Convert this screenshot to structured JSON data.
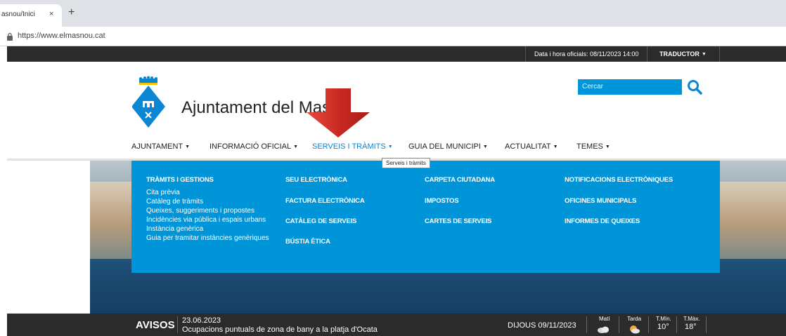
{
  "browser": {
    "tab_title": "asnou/Inici",
    "tab_close": "×",
    "new_tab": "+",
    "url": "https://www.elmasnou.cat"
  },
  "topbar": {
    "datetime": "Data i hora oficials: 08/11/2023 14:00",
    "translator": "TRADUCTOR"
  },
  "header": {
    "title": "Ajuntament del Mas",
    "search_placeholder": "Cercar"
  },
  "nav": {
    "items": [
      {
        "label": "AJUNTAMENT",
        "active": false
      },
      {
        "label": "INFORMACIÓ OFICIAL",
        "active": false
      },
      {
        "label": "SERVEIS I TRÀMITS",
        "active": true
      },
      {
        "label": "GUIA DEL MUNICIPI",
        "active": false
      },
      {
        "label": "ACTUALITAT",
        "active": false
      },
      {
        "label": "TEMES",
        "active": false
      }
    ],
    "tooltip": "Serveis i tràmits"
  },
  "mega_menu": {
    "col1": {
      "heading": "TRÀMITS I GESTIONS",
      "links": [
        "Cita prèvia",
        "Catàleg de tràmits",
        "Queixes, suggeriments i propostes",
        "Incidències via pública i espais urbans",
        "Instància genèrica",
        "Guia per tramitar instàncies genèriques"
      ]
    },
    "col2": [
      "SEU ELECTRÒNICA",
      "FACTURA ELECTRÒNICA",
      "CATÀLEG DE SERVEIS",
      "BÚSTIA ÈTICA"
    ],
    "col3": [
      "CARPETA CIUTADANA",
      "IMPOSTOS",
      "CARTES DE SERVEIS"
    ],
    "col4": [
      "NOTIFICACIONS ELECTRÒNIQUES",
      "OFICINES MUNICIPALS",
      "INFORMES DE QUEIXES"
    ]
  },
  "alerts": {
    "label": "AVISOS",
    "date": "23.06.2023",
    "text": "Ocupacions puntuals de zona de bany a la platja d'Ocata",
    "today": "DIJOUS 09/11/2023"
  },
  "weather": {
    "morning_label": "Matí",
    "afternoon_label": "Tarda",
    "tmin_label": "T.Mín.",
    "tmin": "10°",
    "tmax_label": "T.Màx.",
    "tmax": "18°",
    "morning_icon": "cloud-icon",
    "afternoon_icon": "sun-cloud-icon"
  },
  "colors": {
    "accent": "#0095d8",
    "nav_active": "#0b86d4",
    "dark_bar": "#2b2b2b",
    "arrow": "#d6312b"
  }
}
